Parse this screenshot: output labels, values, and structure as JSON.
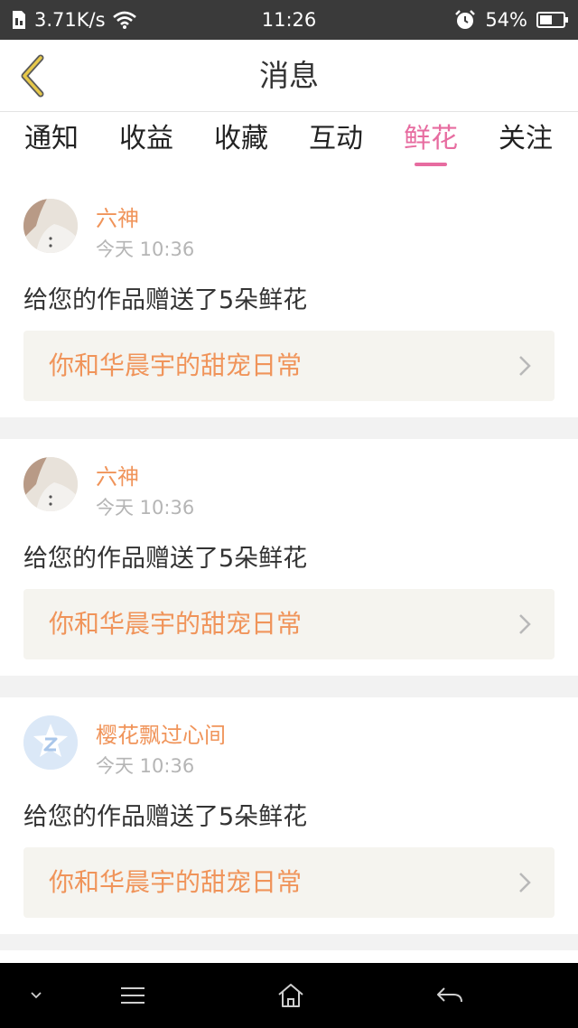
{
  "status_bar": {
    "network_speed": "3.71K/s",
    "time": "11:26",
    "battery": "54%",
    "icons": [
      "sim-icon",
      "wifi-icon",
      "alarm-icon",
      "battery-icon"
    ]
  },
  "header": {
    "title": "消息",
    "back_icon": "chevron-left-icon",
    "accent_color": "#e6c84a"
  },
  "tabs": [
    {
      "label": "通知",
      "active": false
    },
    {
      "label": "收益",
      "active": false
    },
    {
      "label": "收藏",
      "active": false
    },
    {
      "label": "互动",
      "active": false
    },
    {
      "label": "鲜花",
      "active": true
    },
    {
      "label": "关注",
      "active": false
    }
  ],
  "active_tab_color": "#e76ca0",
  "messages": [
    {
      "sender": "六神",
      "time": "今天 10:36",
      "text": "给您的作品赠送了5朵鲜花",
      "work_title": "你和华晨宇的甜宠日常",
      "avatar": "photo-avatar"
    },
    {
      "sender": "六神",
      "time": "今天 10:36",
      "text": "给您的作品赠送了5朵鲜花",
      "work_title": "你和华晨宇的甜宠日常",
      "avatar": "photo-avatar"
    },
    {
      "sender": "樱花飘过心间",
      "time": "今天 10:36",
      "text": "给您的作品赠送了5朵鲜花",
      "work_title": "你和华晨宇的甜宠日常",
      "avatar": "default-avatar"
    }
  ],
  "colors": {
    "name_and_link": "#f0945a",
    "timestamp": "#b5b5b5",
    "link_background": "#f5f4ef"
  },
  "nav_bar": [
    "chevron-down-icon",
    "menu-icon",
    "home-icon",
    "back-arrow-icon"
  ]
}
